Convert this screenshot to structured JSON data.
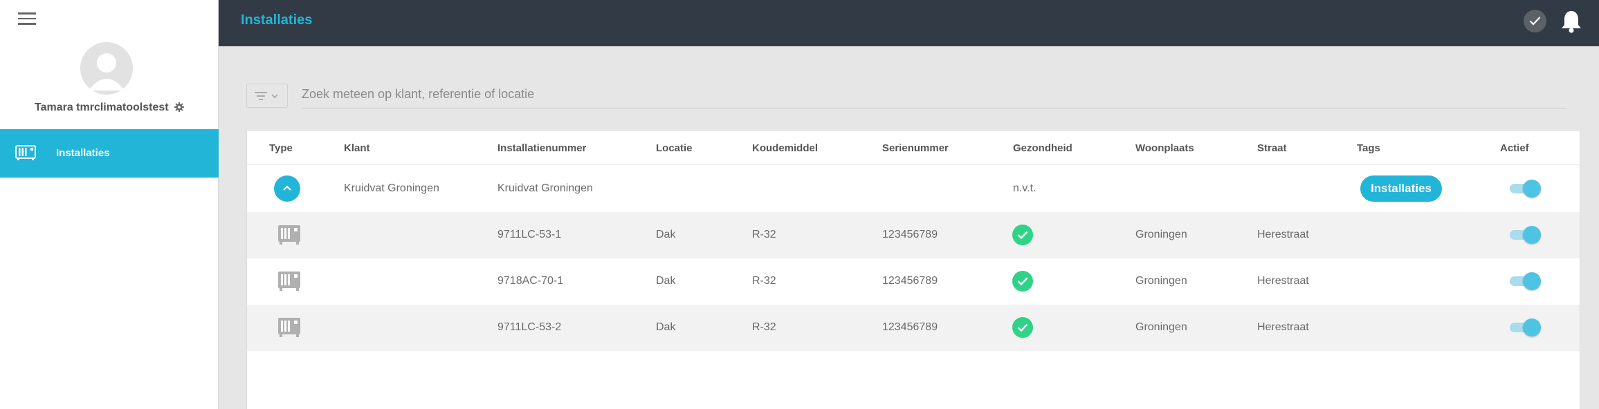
{
  "sidebar": {
    "user_name": "Tamara tmrclimatoolstest",
    "nav_items": [
      {
        "label": "Installaties",
        "active": true
      }
    ]
  },
  "header": {
    "title": "Installaties"
  },
  "search": {
    "placeholder": "Zoek meteen op klant, referentie of locatie",
    "value": ""
  },
  "table": {
    "columns": [
      "Type",
      "Klant",
      "Installatienummer",
      "Locatie",
      "Koudemiddel",
      "Serienummer",
      "Gezondheid",
      "Woonplaats",
      "Straat",
      "Tags",
      "Actief"
    ],
    "group_row": {
      "klant": "Kruidvat Groningen",
      "installatienummer": "Kruidvat Groningen",
      "gezondheid": "n.v.t.",
      "tag": "Installaties",
      "actief": true
    },
    "rows": [
      {
        "installatienummer": "9711LC-53-1",
        "locatie": "Dak",
        "koudemiddel": "R-32",
        "serienummer": "123456789",
        "gezondheid": "ok",
        "woonplaats": "Groningen",
        "straat": "Herestraat",
        "actief": true
      },
      {
        "installatienummer": "9718AC-70-1",
        "locatie": "Dak",
        "koudemiddel": "R-32",
        "serienummer": "123456789",
        "gezondheid": "ok",
        "woonplaats": "Groningen",
        "straat": "Herestraat",
        "actief": true
      },
      {
        "installatienummer": "9711LC-53-2",
        "locatie": "Dak",
        "koudemiddel": "R-32",
        "serienummer": "123456789",
        "gezondheid": "ok",
        "woonplaats": "Groningen",
        "straat": "Herestraat",
        "actief": true
      }
    ]
  },
  "colors": {
    "accent": "#23b5d8",
    "header_bg": "#323a45",
    "health_ok": "#2ed388",
    "page_bg": "#e6e6e6"
  },
  "icons": [
    "menu-icon",
    "avatar-placeholder",
    "gear-icon",
    "ac-unit-icon",
    "check-icon",
    "bell-icon",
    "filter-icon",
    "chevron-up-icon"
  ]
}
